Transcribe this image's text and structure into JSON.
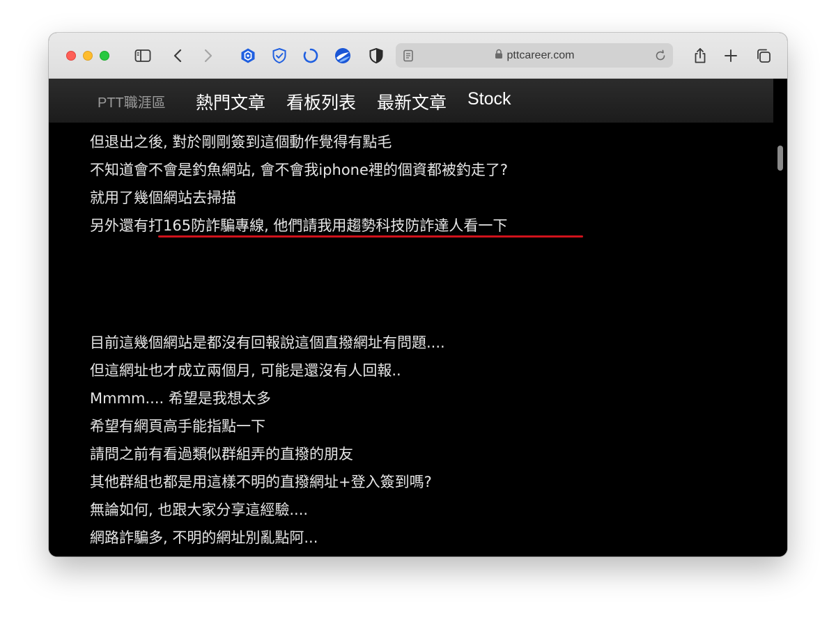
{
  "browser": {
    "url": "pttcareer.com",
    "icons": {
      "close": "window-close-button",
      "minimize": "window-minimize-button",
      "zoom": "window-zoom-button",
      "sidebar": "sidebar-toggle-icon",
      "back": "chevron-left-icon",
      "forward": "chevron-right-icon",
      "ext1": "hexagon-shield-icon",
      "ext2": "shield-check-icon",
      "ext3": "loading-arc-icon",
      "ext4": "globe-ball-icon",
      "ext5": "half-shield-icon",
      "reader": "reader-view-icon",
      "lock": "lock-icon",
      "reload": "reload-icon",
      "share": "share-icon",
      "new_tab": "plus-icon",
      "tabs": "tab-overview-icon"
    },
    "colors": {
      "close": "#fe5f57",
      "minimize": "#febc2e",
      "zoom": "#28c840",
      "extension_blue": "#1f5fe0"
    }
  },
  "site": {
    "brand": "PTT職涯區",
    "nav": [
      "熱門文章",
      "看板列表",
      "最新文章",
      "Stock"
    ]
  },
  "article": {
    "lines": [
      "但退出之後, 對於剛剛簽到這個動作覺得有點毛",
      "不知道會不會是釣魚網站, 會不會我iphone裡的個資都被釣走了?",
      "就用了幾個網站去掃描",
      "另外還有打165防詐騙專線, 他們請我用趨勢科技防詐達人看一下",
      "目前這幾個網站是都沒有回報說這個直撥網址有問題....",
      "但這網址也才成立兩個月, 可能是還沒有人回報..",
      "Mmmm.... 希望是我想太多",
      "希望有網頁高手能指點一下",
      "請問之前有看過類似群組弄的直撥的朋友",
      "其他群組也都是用這樣不明的直撥網址+登入簽到嗎?",
      "無論如何, 也跟大家分享這經驗....",
      "網路詐騙多, 不明的網址別亂點阿...",
      "--"
    ],
    "highlight_color": "#d0121b"
  }
}
